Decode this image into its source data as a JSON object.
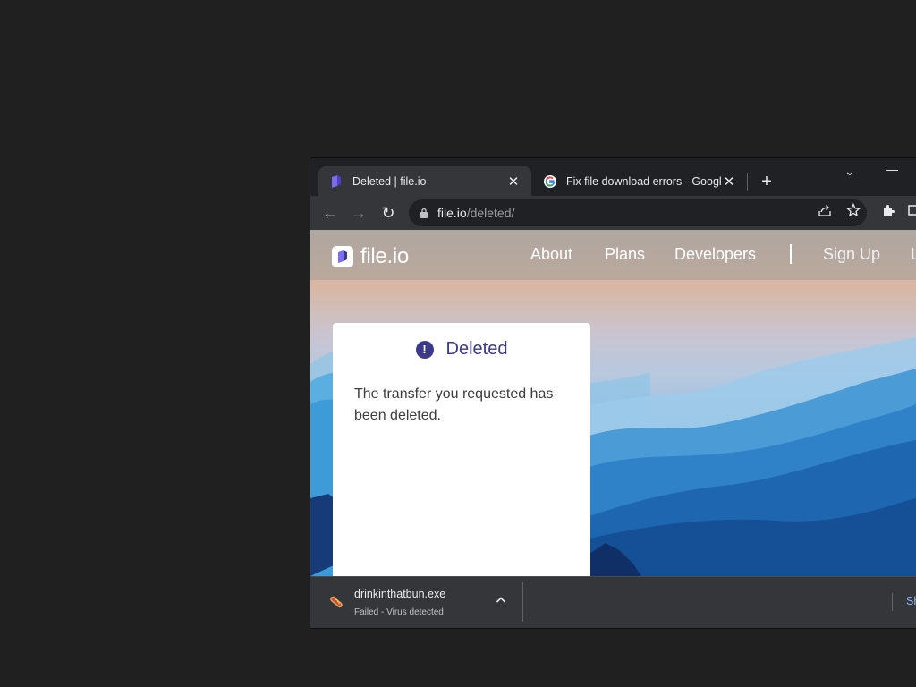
{
  "browser": {
    "tabs": [
      {
        "title": "Deleted | file.io",
        "close": "✕",
        "active": true
      },
      {
        "title": "Fix file download errors - Google",
        "close": "✕",
        "active": false
      }
    ],
    "new_tab": "+",
    "window_controls": {
      "tab_search": "⌄",
      "minimize": "—"
    },
    "nav": {
      "back": "←",
      "forward": "→",
      "reload": "↻"
    },
    "address": {
      "host": "file.io",
      "path": "/deleted/"
    }
  },
  "site": {
    "logo_text": "file.io",
    "nav_links": [
      "About",
      "Plans",
      "Developers",
      "Sign Up",
      "L"
    ]
  },
  "card": {
    "title": "Deleted",
    "icon_glyph": "!",
    "message": "The transfer you requested has been deleted."
  },
  "download_shelf": {
    "filename": "drinkinthatbun.exe",
    "status": "Failed - Virus detected",
    "show_all": "Sh"
  },
  "colors": {
    "brand": "#3d3a8c",
    "chrome_dark": "#202124",
    "chrome_toolbar": "#35363a"
  }
}
